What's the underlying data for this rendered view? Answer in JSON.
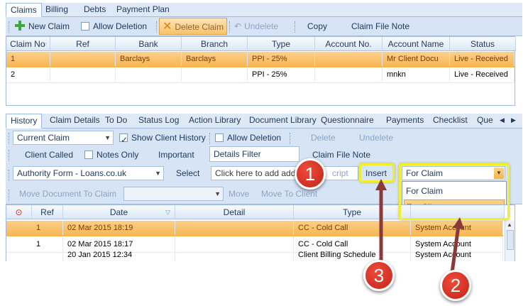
{
  "top_tabs": [
    "Claims",
    "Billing",
    "Debts",
    "Payment Plan"
  ],
  "claims_toolbar": {
    "new_claim": "New Claim",
    "allow_deletion": "Allow Deletion",
    "delete_claim": "Delete Claim",
    "undelete": "Undelete",
    "copy": "Copy",
    "claim_file_note": "Claim File Note"
  },
  "claims_table": {
    "headers": [
      "Claim No",
      "Ref",
      "Bank",
      "Branch",
      "Type",
      "Account No.",
      "Account Name",
      "Status"
    ],
    "rows": [
      [
        "1",
        "",
        "Barclays",
        "Barclays",
        "PPI - 25%",
        "",
        "Mr Client Docu",
        "Live - Received"
      ],
      [
        "2",
        "",
        "",
        "",
        "PPI - 25%",
        "",
        "mnkn",
        "Live - Received"
      ]
    ]
  },
  "bottom_tabs": [
    "History",
    "Claim Details",
    "To Do",
    "Status Log",
    "Action Library",
    "Document Library",
    "Questionnaire",
    "Payments",
    "Checklist",
    "Que"
  ],
  "history_toolbar": {
    "scope_select": "Current Claim",
    "show_client_history": "Show Client History",
    "allow_deletion": "Allow Deletion",
    "delete": "Delete",
    "undelete": "Undelete",
    "client_called": "Client Called",
    "notes_only": "Notes Only",
    "important": "Important",
    "details_filter": "Details Filter",
    "claim_file_note": "Claim File Note",
    "authority_select": "Authority Form - Loans.co.uk",
    "select": "Select",
    "add_placeholder": "Click here to add add",
    "script_fragment": "cript",
    "insert": "Insert",
    "for_select": "For Claim",
    "for_options": [
      "For Claim",
      "For Client"
    ],
    "move_document": "Move Document To Claim",
    "move": "Move",
    "move_to_client": "Move To Client"
  },
  "history_table": {
    "headers": [
      "Ref",
      "Date",
      "Detail",
      "Type",
      ""
    ],
    "rows": [
      [
        "1",
        "02 Mar 2015 18:19",
        "",
        "CC - Cold Call",
        "System Account"
      ],
      [
        "1",
        "02 Mar 2015 18:17",
        "",
        "CC - Cold Call",
        "System Account"
      ],
      [
        "",
        "20 Jan 2015 12:34",
        "",
        "Client Billing Schedule",
        "System Account"
      ]
    ]
  },
  "callouts": [
    "1",
    "2",
    "3"
  ],
  "colors": {
    "accent_orange": "#f7b64f",
    "callout_red": "#d9302a",
    "highlight_yellow": "#f2ef2a"
  }
}
